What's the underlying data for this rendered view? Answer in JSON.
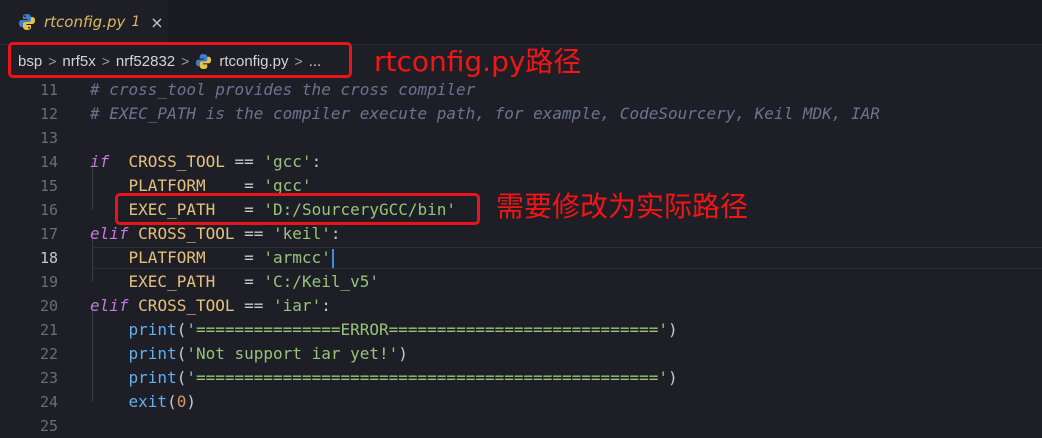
{
  "tab": {
    "title": "rtconfig.py",
    "badge": "1",
    "close_glyph": "×",
    "icon": "python-icon"
  },
  "breadcrumb": {
    "items": [
      "bsp",
      "nrf5x",
      "nrf52832",
      "rtconfig.py",
      "..."
    ],
    "separator": ">"
  },
  "annotations": {
    "path_note": "rtconfig.py路径",
    "edit_note": "需要修改为实际路径"
  },
  "colors": {
    "annotation": "#e8141a",
    "background": "#1e1f26",
    "keyword": "#c678dd",
    "string": "#98c379",
    "identifier": "#e5c07b",
    "function": "#61afef",
    "comment": "#6c7391"
  },
  "editor": {
    "cursor_line": 18,
    "lines": [
      {
        "n": "11",
        "segments": [
          {
            "t": "com",
            "s": "# cross_tool provides the cross compiler"
          }
        ]
      },
      {
        "n": "12",
        "segments": [
          {
            "t": "com",
            "s": "# EXEC_PATH is the compiler execute path, for example, CodeSourcery, Keil MDK, IAR"
          }
        ]
      },
      {
        "n": "13",
        "segments": []
      },
      {
        "n": "14",
        "segments": [
          {
            "t": "kw",
            "s": "if"
          },
          {
            "t": "op",
            "s": "  "
          },
          {
            "t": "id",
            "s": "CROSS_TOOL"
          },
          {
            "t": "op",
            "s": " == "
          },
          {
            "t": "str",
            "s": "'gcc'"
          },
          {
            "t": "op",
            "s": ":"
          }
        ]
      },
      {
        "n": "15",
        "segments": [
          {
            "t": "op",
            "s": "    "
          },
          {
            "t": "id",
            "s": "PLATFORM"
          },
          {
            "t": "op",
            "s": "    = "
          },
          {
            "t": "str",
            "s": "'gcc'"
          }
        ]
      },
      {
        "n": "16",
        "segments": [
          {
            "t": "op",
            "s": "    "
          },
          {
            "t": "id",
            "s": "EXEC_PATH"
          },
          {
            "t": "op",
            "s": "   = "
          },
          {
            "t": "str",
            "s": "'D:/SourceryGCC/bin'"
          }
        ]
      },
      {
        "n": "17",
        "segments": [
          {
            "t": "kw",
            "s": "elif"
          },
          {
            "t": "op",
            "s": " "
          },
          {
            "t": "id",
            "s": "CROSS_TOOL"
          },
          {
            "t": "op",
            "s": " == "
          },
          {
            "t": "str",
            "s": "'keil'"
          },
          {
            "t": "op",
            "s": ":"
          }
        ]
      },
      {
        "n": "18",
        "segments": [
          {
            "t": "op",
            "s": "    "
          },
          {
            "t": "id",
            "s": "PLATFORM"
          },
          {
            "t": "op",
            "s": "    = "
          },
          {
            "t": "str",
            "s": "'armcc'"
          }
        ]
      },
      {
        "n": "19",
        "segments": [
          {
            "t": "op",
            "s": "    "
          },
          {
            "t": "id",
            "s": "EXEC_PATH"
          },
          {
            "t": "op",
            "s": "   = "
          },
          {
            "t": "str",
            "s": "'C:/Keil_v5'"
          }
        ]
      },
      {
        "n": "20",
        "segments": [
          {
            "t": "kw",
            "s": "elif"
          },
          {
            "t": "op",
            "s": " "
          },
          {
            "t": "id",
            "s": "CROSS_TOOL"
          },
          {
            "t": "op",
            "s": " == "
          },
          {
            "t": "str",
            "s": "'iar'"
          },
          {
            "t": "op",
            "s": ":"
          }
        ]
      },
      {
        "n": "21",
        "segments": [
          {
            "t": "op",
            "s": "    "
          },
          {
            "t": "fn",
            "s": "print"
          },
          {
            "t": "par",
            "s": "("
          },
          {
            "t": "str",
            "s": "'===============ERROR============================'"
          },
          {
            "t": "par",
            "s": ")"
          }
        ]
      },
      {
        "n": "22",
        "segments": [
          {
            "t": "op",
            "s": "    "
          },
          {
            "t": "fn",
            "s": "print"
          },
          {
            "t": "par",
            "s": "("
          },
          {
            "t": "str",
            "s": "'Not support iar yet!'"
          },
          {
            "t": "par",
            "s": ")"
          }
        ]
      },
      {
        "n": "23",
        "segments": [
          {
            "t": "op",
            "s": "    "
          },
          {
            "t": "fn",
            "s": "print"
          },
          {
            "t": "par",
            "s": "("
          },
          {
            "t": "str",
            "s": "'================================================'"
          },
          {
            "t": "par",
            "s": ")"
          }
        ]
      },
      {
        "n": "24",
        "segments": [
          {
            "t": "op",
            "s": "    "
          },
          {
            "t": "fn",
            "s": "exit"
          },
          {
            "t": "par",
            "s": "("
          },
          {
            "t": "num",
            "s": "0"
          },
          {
            "t": "par",
            "s": ")"
          }
        ]
      },
      {
        "n": "25",
        "segments": []
      }
    ]
  }
}
